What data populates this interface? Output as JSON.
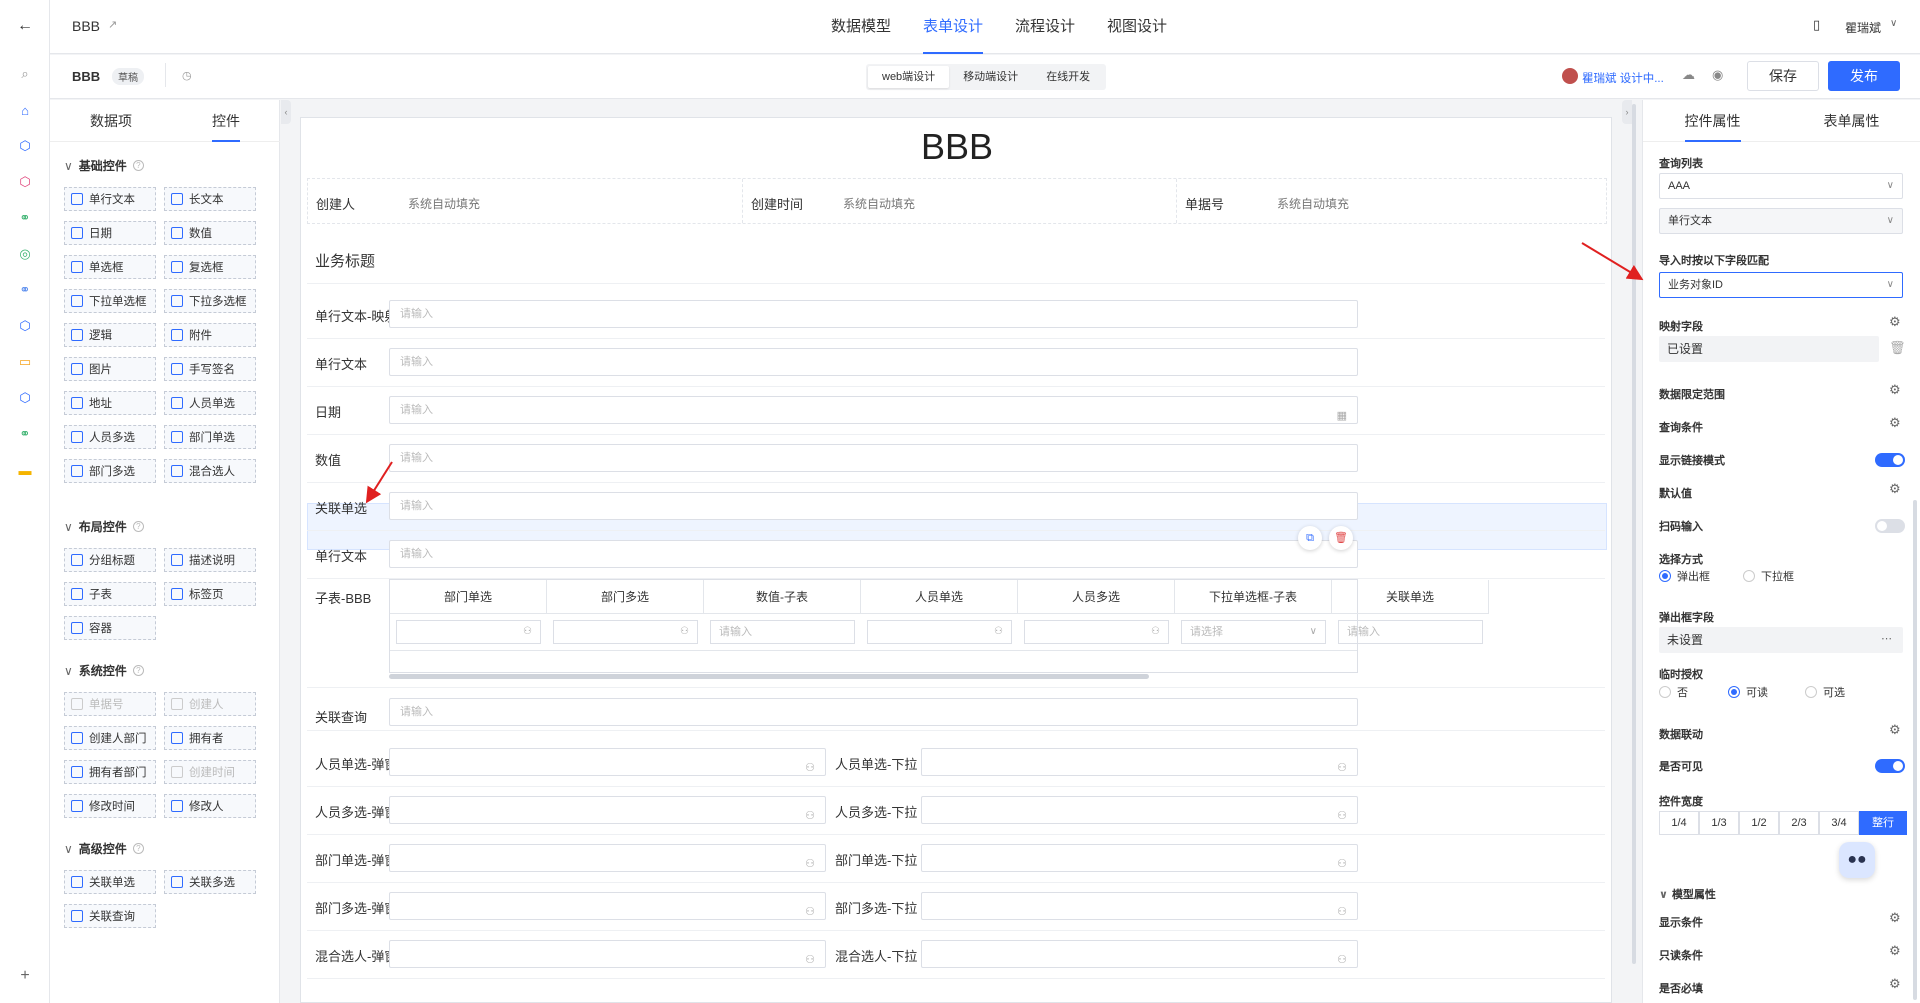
{
  "app": {
    "title": "BBB",
    "user": "瞿瑞斌"
  },
  "toptabs": [
    "数据模型",
    "表单设计",
    "流程设计",
    "视图设计"
  ],
  "subbar": {
    "name": "BBB",
    "badge": "草稿",
    "modes": [
      "web端设计",
      "移动端设计",
      "在线开发"
    ],
    "editing": "瞿瑞斌 设计中...",
    "save": "保存",
    "publish": "发布"
  },
  "left": {
    "tabs": [
      "数据项",
      "控件"
    ],
    "groups": [
      {
        "title": "基础控件",
        "items": [
          "单行文本",
          "长文本",
          "日期",
          "数值",
          "单选框",
          "复选框",
          "下拉单选框",
          "下拉多选框",
          "逻辑",
          "附件",
          "图片",
          "手写签名",
          "地址",
          "人员单选",
          "人员多选",
          "部门单选",
          "部门多选",
          "混合选人"
        ]
      },
      {
        "title": "布局控件",
        "items": [
          "分组标题",
          "描述说明",
          "子表",
          "标签页",
          "容器"
        ]
      },
      {
        "title": "系统控件",
        "items": [
          "单据号",
          "创建人",
          "创建人部门",
          "拥有者",
          "拥有者部门",
          "创建时间",
          "修改时间",
          "修改人"
        ]
      },
      {
        "title": "高级控件",
        "items": [
          "关联单选",
          "关联多选",
          "关联查询"
        ]
      }
    ]
  },
  "form": {
    "title": "BBB",
    "meta": [
      {
        "label": "创建人",
        "value": "系统自动填充"
      },
      {
        "label": "创建时间",
        "value": "系统自动填充"
      },
      {
        "label": "单据号",
        "value": "系统自动填充"
      }
    ],
    "section": "业务标题",
    "placeholder": "请输入",
    "fields": [
      "单行文本-映射...",
      "单行文本",
      "日期",
      "数值",
      "关联单选",
      "单行文本"
    ],
    "subtable": {
      "label": "子表-BBB",
      "columns": [
        "部门单选",
        "部门多选",
        "数值-子表",
        "人员单选",
        "人员多选",
        "下拉单选框-子表",
        "关联单选"
      ],
      "cells": [
        "",
        "",
        "请输入",
        "",
        "",
        "请选择",
        "请输入"
      ]
    },
    "query": "关联查询",
    "pairs": [
      [
        "人员单选-弹窗",
        "人员单选-下拉"
      ],
      [
        "人员多选-弹窗",
        "人员多选-下拉"
      ],
      [
        "部门单选-弹窗",
        "部门单选-下拉"
      ],
      [
        "部门多选-弹窗",
        "部门多选-下拉"
      ],
      [
        "混合选人-弹窗",
        "混合选人-下拉"
      ]
    ]
  },
  "right": {
    "tabs": [
      "控件属性",
      "表单属性"
    ],
    "query_list_label": "查询列表",
    "query_list_value": "AAA",
    "query_field_value": "单行文本",
    "import_label": "导入时按以下字段匹配",
    "import_value": "业务对象ID",
    "mapping_label": "映射字段",
    "mapping_value": "已设置",
    "range_label": "数据限定范围",
    "cond_label": "查询条件",
    "link_label": "显示链接模式",
    "default_label": "默认值",
    "scan_label": "扫码输入",
    "select_mode_label": "选择方式",
    "select_modes": [
      "弹出框",
      "下拉框"
    ],
    "popup_label": "弹出框字段",
    "popup_value": "未设置",
    "auth_label": "临时授权",
    "auth_options": [
      "否",
      "可读",
      "可选"
    ],
    "linkage_label": "数据联动",
    "visible_label": "是否可见",
    "width_label": "控件宽度",
    "widths": [
      "1/4",
      "1/3",
      "1/2",
      "2/3",
      "3/4",
      "整行"
    ],
    "model_label": "模型属性",
    "show_cond": "显示条件",
    "readonly_cond": "只读条件",
    "required": "是否必填"
  }
}
